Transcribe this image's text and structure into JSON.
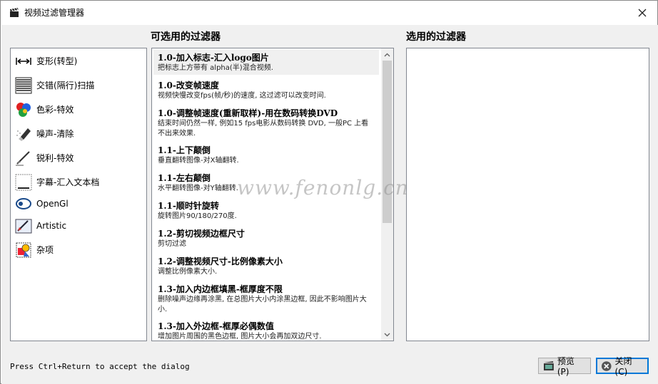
{
  "window": {
    "title": "视频过滤管理器"
  },
  "headings": {
    "available": "可选用的过滤器",
    "selected": "选用的过滤器"
  },
  "categories": [
    {
      "label": "变形(转型)",
      "icon": "transform-arrows-icon"
    },
    {
      "label": "交错(隔行)扫描",
      "icon": "interlace-lines-icon"
    },
    {
      "label": "色彩-特效",
      "icon": "color-circles-icon"
    },
    {
      "label": "噪声-清除",
      "icon": "eraser-icon"
    },
    {
      "label": "锐利-特效",
      "icon": "sharpen-brush-icon"
    },
    {
      "label": "字幕-汇入文本档",
      "icon": "subtitle-abc-icon"
    },
    {
      "label": "OpenGl",
      "icon": "opengl-icon"
    },
    {
      "label": "Artistic",
      "icon": "artistic-pen-icon"
    },
    {
      "label": "杂项",
      "icon": "misc-shapes-icon"
    }
  ],
  "filters": [
    {
      "title": "1.0-加入标志-汇入logo图片",
      "desc": "把标志上方带有 alpha(半)混合视频."
    },
    {
      "title": "1.0-改变帧速度",
      "desc": "视频快慢改变fps(帧/秒)的速度, 这过滤可以改变时间."
    },
    {
      "title": "1.0-调整帧速度(重新取样)-用在数码转换DVD",
      "desc": "结束时间仍然一样, 例如15 fps电影从数码转换 DVD, 一般PC 上看不出来效果."
    },
    {
      "title": "1.1-上下颠倒",
      "desc": "垂直翻转图像-对X轴翻转."
    },
    {
      "title": "1.1-左右颠倒",
      "desc": "水平翻转图像-对Y轴翻转."
    },
    {
      "title": "1.1-顺时针旋转",
      "desc": "旋转图片90/180/270度."
    },
    {
      "title": "1.2-剪切视频边框尺寸",
      "desc": "剪切过滤"
    },
    {
      "title": "1.2-调整视频尺寸-比例像素大小",
      "desc": "调整比例像素大小."
    },
    {
      "title": "1.3-加入内边框填黑-框厚度不限",
      "desc": "删除噪声边缘再涂黑, 在总图片大小内涂黑边框, 因此不影响图片大小."
    },
    {
      "title": "1.3-加入外边框-框厚必偶数值",
      "desc": "增加图片周围的黑色边框, 图片大小会再加双边尺寸."
    }
  ],
  "footer": {
    "hint": "Press Ctrl+Return to accept the dialog",
    "preview_label": "预览(P)",
    "close_label": "关闭(C)"
  },
  "watermark": "www.fenonlg.cn",
  "colors": {
    "accent": "#0078d7",
    "panel_border": "#828790",
    "client_bg": "#f0f0f0"
  }
}
